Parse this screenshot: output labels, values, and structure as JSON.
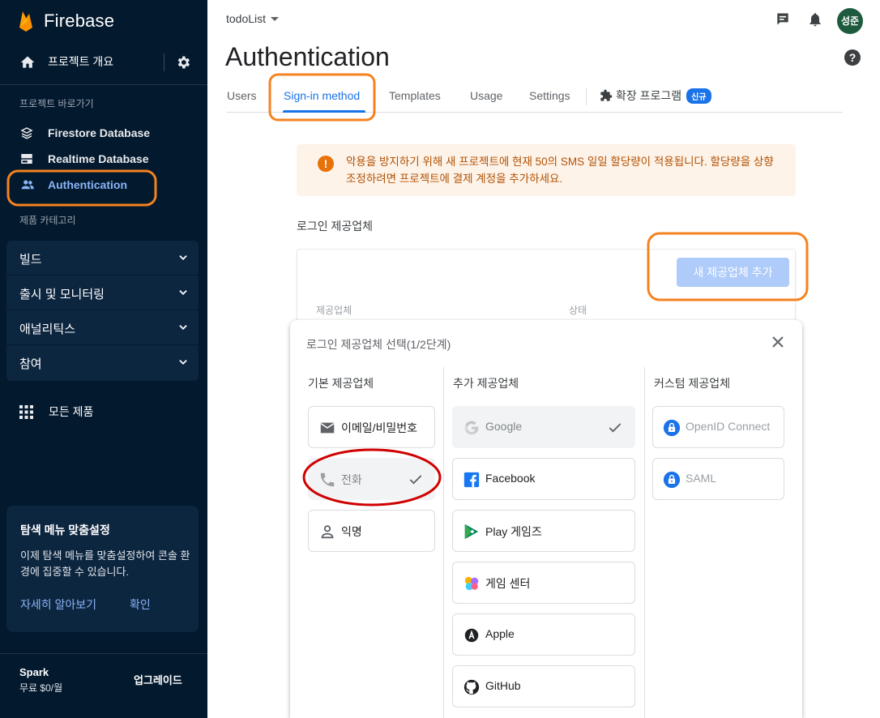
{
  "sidebar": {
    "brand": "Firebase",
    "overview_label": "프로젝트 개요",
    "shortcuts_title": "프로젝트 바로가기",
    "shortcuts": [
      {
        "label": "Firestore Database"
      },
      {
        "label": "Realtime Database"
      },
      {
        "label": "Authentication"
      }
    ],
    "categories_title": "제품 카테고리",
    "categories": [
      {
        "label": "빌드"
      },
      {
        "label": "출시 및 모니터링"
      },
      {
        "label": "애널리틱스"
      },
      {
        "label": "참여"
      }
    ],
    "all_products": "모든 제품",
    "promo": {
      "title": "탐색 메뉴 맞춤설정",
      "body": "이제 탐색 메뉴를 맞춤설정하여 콘솔 환경에 집중할 수 있습니다.",
      "learn_more": "자세히 알아보기",
      "confirm": "확인"
    },
    "plan": {
      "name": "Spark",
      "price": "무료 $0/월",
      "upgrade": "업그레이드"
    }
  },
  "header": {
    "project": "todoList",
    "avatar": "성준",
    "title": "Authentication",
    "help": "?"
  },
  "tabs": [
    {
      "label": "Users"
    },
    {
      "label": "Sign-in method"
    },
    {
      "label": "Templates"
    },
    {
      "label": "Usage"
    },
    {
      "label": "Settings"
    }
  ],
  "extensions_tab": {
    "label": "확장 프로그램",
    "badge": "신규"
  },
  "warning": {
    "text": "악용을 방지하기 위해 새 프로젝트에 현재 50의 SMS 일일 할당량이 적용됩니다. 할당량을 상향 조정하려면 프로젝트에 결제 계정을 추가하세요."
  },
  "providers": {
    "title": "로그인 제공업체",
    "add_button": "새 제공업체 추가",
    "col_provider": "제공업체",
    "col_status": "상태"
  },
  "panel": {
    "title": "로그인 제공업체 선택(1/2단계)",
    "native_title": "기본 제공업체",
    "additional_title": "추가 제공업체",
    "custom_title": "커스텀 제공업체",
    "native": [
      {
        "label": "이메일/비밀번호",
        "icon": "mail-icon"
      },
      {
        "label": "전화",
        "icon": "phone-icon"
      },
      {
        "label": "익명",
        "icon": "person-icon"
      }
    ],
    "additional": [
      {
        "label": "Google",
        "icon": "google-icon"
      },
      {
        "label": "Facebook",
        "icon": "facebook-icon"
      },
      {
        "label": "Play 게임즈",
        "icon": "play-games-icon"
      },
      {
        "label": "게임 센터",
        "icon": "game-center-icon"
      },
      {
        "label": "Apple",
        "icon": "apple-icon"
      },
      {
        "label": "GitHub",
        "icon": "github-icon"
      }
    ],
    "custom": [
      {
        "label": "OpenID Connect",
        "icon": "lock-icon"
      },
      {
        "label": "SAML",
        "icon": "lock-icon"
      }
    ]
  },
  "colors": {
    "sidebar_bg": "#03192e",
    "accent": "#1a73e8",
    "warning_text": "#b05206",
    "annotation_orange": "#f5821f",
    "annotation_red": "#d00000"
  }
}
